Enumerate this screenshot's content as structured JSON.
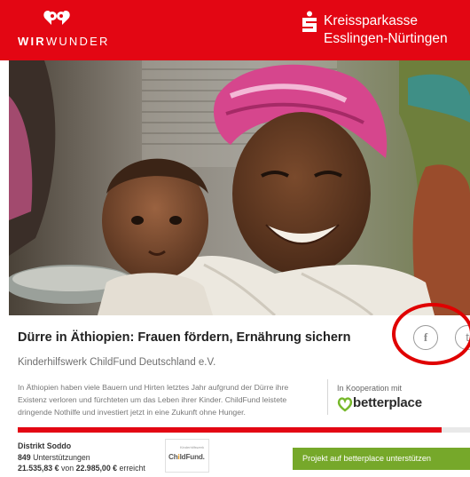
{
  "header": {
    "brand_prefix": "WIR",
    "brand_suffix": "WUNDER",
    "bank_line1": "Kreissparkasse",
    "bank_line2": "Esslingen-Nürtingen",
    "colors": {
      "header_bg": "#e30613",
      "brand_text": "#ffffff"
    }
  },
  "project": {
    "title": "Dürre in Äthiopien: Frauen fördern, Ernährung sichern",
    "organization": "Kinderhilfswerk ChildFund Deutschland e.V.",
    "description": "In Äthiopien haben viele Bauern und Hirten letztes Jahr aufgrund der Dürre ihre Existenz verloren und fürchteten um das Leben ihrer Kinder. ChildFund leistete dringende Nothilfe und investiert jetzt in eine Zukunft ohne Hunger."
  },
  "share": {
    "facebook_icon": "f",
    "twitter_icon": "t"
  },
  "cooperation": {
    "label": "In Kooperation mit",
    "partner": "betterplace"
  },
  "funding": {
    "progress_fraction": 0.937,
    "district": "Distrikt Soddo",
    "supporters_count": "849",
    "supporters_label": "Unterstützungen",
    "raised": "21.535,83 €",
    "of_label": "von",
    "goal": "22.985,00 €",
    "reached_label": "erreicht"
  },
  "org_logo": {
    "tagline": "Kinderhilfswerk",
    "name_a": "Ch",
    "name_o": "i",
    "name_b": "ldFund."
  },
  "cta": {
    "label": "Projekt auf betterplace unterstützen"
  },
  "colors": {
    "accent_red": "#e30613",
    "cta_green": "#76a82a",
    "annotation_circle": "#e00000"
  }
}
